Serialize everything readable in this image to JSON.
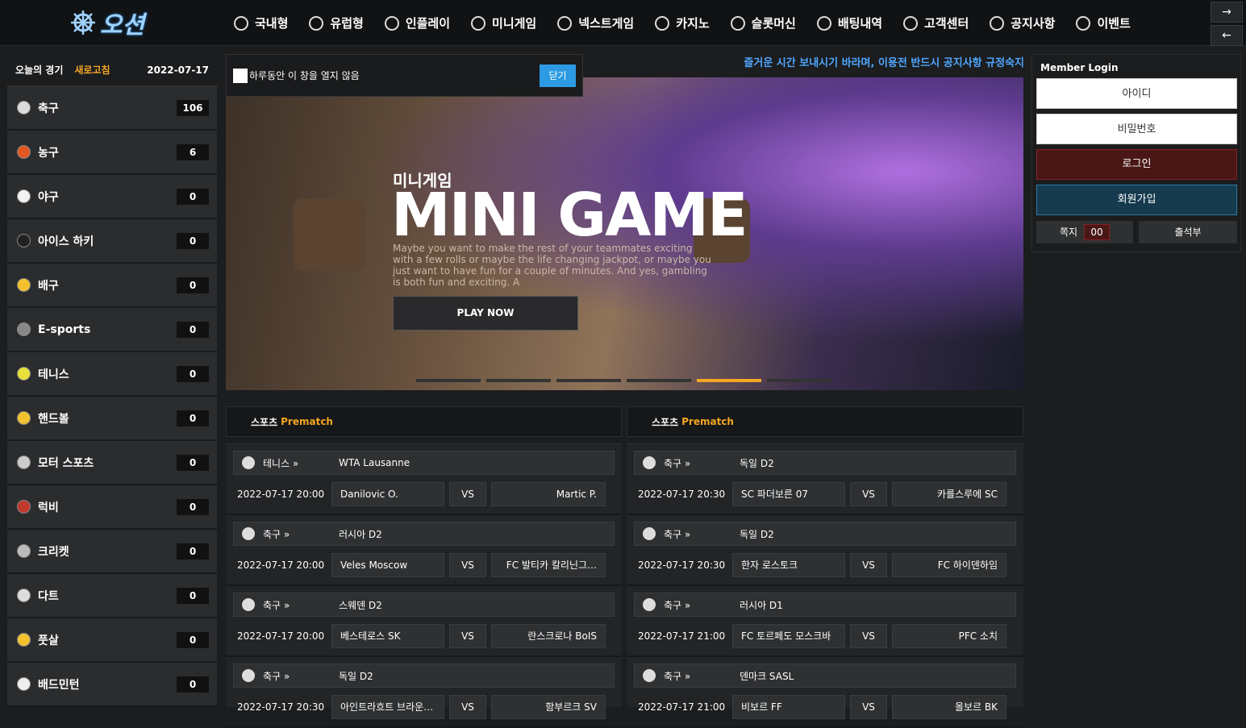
{
  "logo": {
    "text": "오션"
  },
  "nav": [
    {
      "label": "국내형",
      "icon": "soccer-ball-icon"
    },
    {
      "label": "유럽형",
      "icon": "soccer-ball-icon"
    },
    {
      "label": "인플레이",
      "icon": "live-circle-icon"
    },
    {
      "label": "미니게임",
      "icon": "gamepad-icon"
    },
    {
      "label": "넥스트게임",
      "icon": "gear-icon"
    },
    {
      "label": "카지노",
      "icon": "cards-icon"
    },
    {
      "label": "슬롯머신",
      "icon": "slot-icon"
    },
    {
      "label": "배팅내역",
      "icon": "target-icon"
    },
    {
      "label": "고객센터",
      "icon": "headset-icon"
    },
    {
      "label": "공지사항",
      "icon": "document-icon"
    },
    {
      "label": "이벤트",
      "icon": "diamond-icon"
    }
  ],
  "side_arrows": {
    "forward": "→",
    "back": "←"
  },
  "left": {
    "title": "오늘의 경기",
    "refresh": "새로고침",
    "date": "2022-07-17",
    "sports": [
      {
        "name": "축구",
        "count": "106",
        "color": "#dddddd"
      },
      {
        "name": "농구",
        "count": "6",
        "color": "#e25822"
      },
      {
        "name": "야구",
        "count": "0",
        "color": "#f2f2f2"
      },
      {
        "name": "아이스 하키",
        "count": "0",
        "color": "#222222"
      },
      {
        "name": "배구",
        "count": "0",
        "color": "#f2c12e"
      },
      {
        "name": "E-sports",
        "count": "0",
        "color": "#888888"
      },
      {
        "name": "테니스",
        "count": "0",
        "color": "#e8e13a"
      },
      {
        "name": "핸드볼",
        "count": "0",
        "color": "#f2c12e"
      },
      {
        "name": "모터 스포츠",
        "count": "0",
        "color": "#cccccc"
      },
      {
        "name": "럭비",
        "count": "0",
        "color": "#c0392b"
      },
      {
        "name": "크리켓",
        "count": "0",
        "color": "#bbbbbb"
      },
      {
        "name": "다트",
        "count": "0",
        "color": "#dddddd"
      },
      {
        "name": "풋살",
        "count": "0",
        "color": "#f2c12e"
      },
      {
        "name": "배드민턴",
        "count": "0",
        "color": "#eeeeee"
      }
    ]
  },
  "popup": {
    "checkbox_label": "하루동안 이 창을 열지 않음",
    "close": "닫기"
  },
  "marquee": "즐거운 시간 보내시기 바라며, 이용전 반드시 공지사항 규정숙지",
  "banner": {
    "subtitle": "미니게임",
    "title": "MINI GAME",
    "desc": "Maybe you want to make the rest of your teammates exciting with a few rolls or maybe the life changing jackpot, or maybe you just want to have fun for a couple of minutes. And yes, gambling is both fun and exciting. A",
    "button": "PLAY NOW"
  },
  "panels": [
    {
      "title": "스포츠",
      "tag": "Prematch",
      "matches": [
        {
          "sport": "테니스 »",
          "league": "WTA Lausanne",
          "time": "2022-07-17 20:00",
          "home": "Danilovic O.",
          "vs": "VS",
          "away": "Martic P."
        },
        {
          "sport": "축구 »",
          "league": "러시아 D2",
          "time": "2022-07-17 20:00",
          "home": "Veles Moscow",
          "vs": "VS",
          "away": "FC 발티카 칼리닌그…"
        },
        {
          "sport": "축구 »",
          "league": "스웨덴 D2",
          "time": "2022-07-17 20:00",
          "home": "베스테로스 SK",
          "vs": "VS",
          "away": "란스크로나 BoIS"
        },
        {
          "sport": "축구 »",
          "league": "독일 D2",
          "time": "2022-07-17 20:30",
          "home": "아인트라흐트 브라운…",
          "vs": "VS",
          "away": "함부르크 SV"
        }
      ]
    },
    {
      "title": "스포츠",
      "tag": "Prematch",
      "matches": [
        {
          "sport": "축구 »",
          "league": "독일 D2",
          "time": "2022-07-17 20:30",
          "home": "SC 파더보른 07",
          "vs": "VS",
          "away": "카를스루에 SC"
        },
        {
          "sport": "축구 »",
          "league": "독일 D2",
          "time": "2022-07-17 20:30",
          "home": "한자 로스토크",
          "vs": "VS",
          "away": "FC 하이덴하임"
        },
        {
          "sport": "축구 »",
          "league": "러시아 D1",
          "time": "2022-07-17 21:00",
          "home": "FC 토르페도 모스크바",
          "vs": "VS",
          "away": "PFC 소치"
        },
        {
          "sport": "축구 »",
          "league": "덴마크 SASL",
          "time": "2022-07-17 21:00",
          "home": "비보르 FF",
          "vs": "VS",
          "away": "올보르 BK"
        }
      ]
    }
  ],
  "login": {
    "title": "Member Login",
    "id_placeholder": "아이디",
    "pw_placeholder": "비밀번호",
    "login": "로그인",
    "join": "회원가입",
    "message": "쪽지",
    "message_count": "00",
    "attendance": "출석부"
  }
}
